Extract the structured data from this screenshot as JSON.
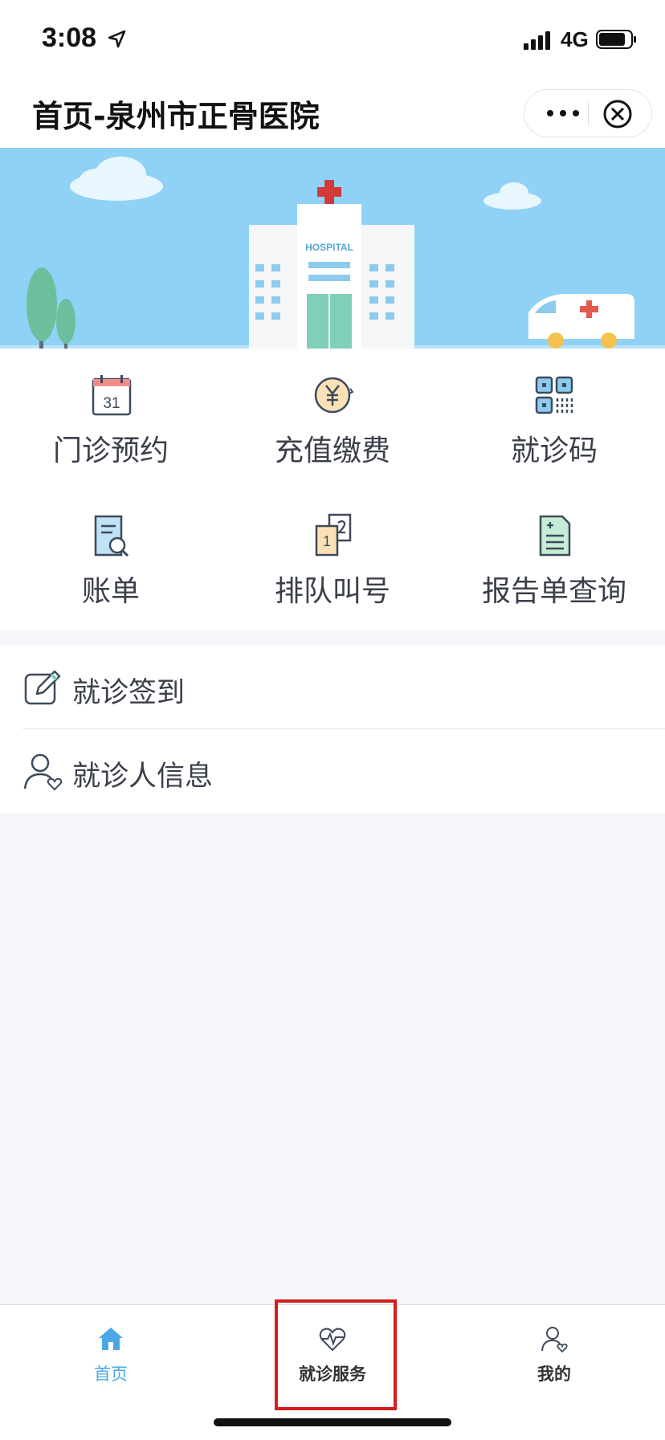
{
  "status_bar": {
    "time": "3:08",
    "network": "4G"
  },
  "navbar": {
    "title": "首页-泉州市正骨医院"
  },
  "banner": {
    "building_sign": "HOSPITAL"
  },
  "grid": [
    {
      "label": "门诊预约",
      "icon": "calendar-icon",
      "calendar_day": "31"
    },
    {
      "label": "充值缴费",
      "icon": "yuan-coin-icon"
    },
    {
      "label": "就诊码",
      "icon": "qr-code-icon"
    },
    {
      "label": "账单",
      "icon": "bill-search-icon"
    },
    {
      "label": "排队叫号",
      "icon": "queue-number-icon",
      "queue_number": "1"
    },
    {
      "label": "报告单查询",
      "icon": "report-icon"
    }
  ],
  "list": [
    {
      "label": "就诊签到",
      "icon": "edit-checkin-icon"
    },
    {
      "label": "就诊人信息",
      "icon": "patient-info-icon"
    }
  ],
  "tabbar": [
    {
      "label": "首页",
      "icon": "home-icon",
      "active": true
    },
    {
      "label": "就诊服务",
      "icon": "heart-pulse-icon",
      "active": false
    },
    {
      "label": "我的",
      "icon": "user-icon",
      "active": false
    }
  ],
  "colors": {
    "accent": "#4aa8e6",
    "highlight_box": "#d31f1f",
    "banner_sky": "#8fd2f6"
  }
}
